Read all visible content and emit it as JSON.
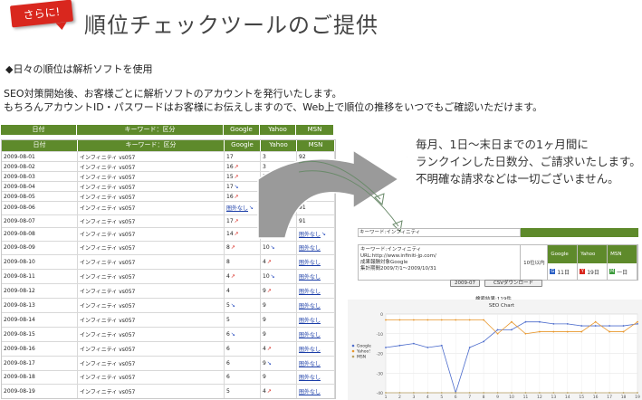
{
  "badge": "さらに!",
  "title": "順位チェックツールのご提供",
  "heading": "◆日々の順位は解析ソフトを使用",
  "desc": [
    "SEO対策開始後、お客様ごとに解析ソフトのアカウントを発行いたします。",
    "もちろんアカウントID・パスワードはお客様にお伝えしますので、Web上で順位の推移をいつでもご確認いただけます。"
  ],
  "notice": [
    "毎月、1日〜末日までの1ヶ月間に",
    "ランクインした日数分、ご請求いたします。",
    "不明確な請求などは一切ございません。"
  ],
  "table": {
    "headers": [
      "日付",
      "キーワード：区分",
      "Google",
      "Yahoo",
      "MSN"
    ],
    "rows": [
      {
        "date": "2009-08-01",
        "kw": "インフィニティ vs057",
        "google": "17",
        "gArr": "",
        "yahoo": "3",
        "yArr": "",
        "msn": "92",
        "mArr": ""
      },
      {
        "date": "2009-08-02",
        "kw": "インフィニティ vs057",
        "google": "16",
        "gArr": "↗",
        "yahoo": "3",
        "yArr": "",
        "msn": "90",
        "mArr": "↗"
      },
      {
        "date": "2009-08-03",
        "kw": "インフィニティ vs057",
        "google": "15",
        "gArr": "↗",
        "yahoo": "3",
        "yArr": "",
        "msn": "",
        "mArr": ""
      },
      {
        "date": "2009-08-04",
        "kw": "インフィニティ vs057",
        "google": "17",
        "gArr": "↘",
        "yahoo": "3",
        "yArr": "",
        "msn": "",
        "mArr": ""
      },
      {
        "date": "2009-08-05",
        "kw": "インフィニティ vs057",
        "google": "16",
        "gArr": "↗",
        "yahoo": "3",
        "yArr": "",
        "msn": "91",
        "mArr": "↘"
      },
      {
        "date": "2009-08-06",
        "kw": "インフィニティ vs057",
        "google": "圏外なし",
        "gArr": "↘",
        "yahoo": "",
        "yArr": "",
        "msn": "91",
        "mArr": ""
      },
      {
        "date": "2009-08-07",
        "kw": "インフィニティ vs057",
        "google": "17",
        "gArr": "↗",
        "yahoo": "",
        "yArr": "",
        "msn": "91",
        "mArr": ""
      },
      {
        "date": "2009-08-08",
        "kw": "インフィニティ vs057",
        "google": "14",
        "gArr": "↗",
        "yahoo": "",
        "yArr": "",
        "msn": "圏外なし",
        "mArr": "↘"
      },
      {
        "date": "2009-08-09",
        "kw": "インフィニティ vs057",
        "google": "8",
        "gArr": "↗",
        "yahoo": "10",
        "yArr": "↘",
        "msn": "圏外なし",
        "mArr": ""
      },
      {
        "date": "2009-08-10",
        "kw": "インフィニティ vs057",
        "google": "8",
        "gArr": "",
        "yahoo": "4",
        "yArr": "↗",
        "msn": "圏外なし",
        "mArr": ""
      },
      {
        "date": "2009-08-11",
        "kw": "インフィニティ vs057",
        "google": "4",
        "gArr": "↗",
        "yahoo": "10",
        "yArr": "↘",
        "msn": "圏外なし",
        "mArr": ""
      },
      {
        "date": "2009-08-12",
        "kw": "インフィニティ vs057",
        "google": "4",
        "gArr": "",
        "yahoo": "9",
        "yArr": "↗",
        "msn": "圏外なし",
        "mArr": ""
      },
      {
        "date": "2009-08-13",
        "kw": "インフィニティ vs057",
        "google": "5",
        "gArr": "↘",
        "yahoo": "9",
        "yArr": "",
        "msn": "圏外なし",
        "mArr": ""
      },
      {
        "date": "2009-08-14",
        "kw": "インフィニティ vs057",
        "google": "5",
        "gArr": "",
        "yahoo": "9",
        "yArr": "",
        "msn": "圏外なし",
        "mArr": ""
      },
      {
        "date": "2009-08-15",
        "kw": "インフィニティ vs057",
        "google": "6",
        "gArr": "↘",
        "yahoo": "9",
        "yArr": "",
        "msn": "圏外なし",
        "mArr": ""
      },
      {
        "date": "2009-08-16",
        "kw": "インフィニティ vs057",
        "google": "6",
        "gArr": "",
        "yahoo": "4",
        "yArr": "↗",
        "msn": "圏外なし",
        "mArr": ""
      },
      {
        "date": "2009-08-17",
        "kw": "インフィニティ vs057",
        "google": "6",
        "gArr": "",
        "yahoo": "9",
        "yArr": "↘",
        "msn": "圏外なし",
        "mArr": ""
      },
      {
        "date": "2009-08-18",
        "kw": "インフィニティ vs057",
        "google": "6",
        "gArr": "",
        "yahoo": "9",
        "yArr": "",
        "msn": "圏外なし",
        "mArr": ""
      },
      {
        "date": "2009-08-19",
        "kw": "インフィニティ vs057",
        "google": "5",
        "gArr": "",
        "yahoo": "4",
        "yArr": "↗",
        "msn": "圏外なし",
        "mArr": ""
      }
    ]
  },
  "report": {
    "keyword": "キーワード:インフィニティ",
    "info": [
      "キーワード:インフィニティ",
      "URL:http://www.infiniti-jp.com/",
      "成果報酬対象Google",
      "集計期間2009/7/1〜2009/10/31"
    ],
    "count": "10位以内",
    "google": {
      "label": "Google",
      "value": "11日",
      "mark": "G",
      "color": "#2a5fc4"
    },
    "yahoo": {
      "label": "Yahoo",
      "value": "19日",
      "mark": "Y",
      "color": "#d9271e"
    },
    "msn": {
      "label": "MSN",
      "value": "一日",
      "mark": "M",
      "color": "#3a9a3a"
    },
    "month": "2009-07",
    "csv": "CSVダウンロード",
    "result": "検索結果:119件"
  },
  "colors": {
    "accent": "#d9271e",
    "table_header": "#5e8a2b",
    "link": "#1b3ea8"
  },
  "chart_data": {
    "type": "line",
    "title": "SEO Chart",
    "x": [
      1,
      2,
      3,
      4,
      5,
      6,
      7,
      8,
      9,
      10,
      11,
      12,
      13,
      14,
      15,
      16,
      17,
      18,
      19
    ],
    "ylim": [
      -40,
      0
    ],
    "yticks": [
      0,
      -10,
      -20,
      -30,
      -40
    ],
    "series": [
      {
        "name": "Google",
        "color": "#4c6ccc",
        "values": [
          -17,
          -16,
          -15,
          -17,
          -16,
          -40,
          -17,
          -14,
          -8,
          -8,
          -4,
          -4,
          -5,
          -5,
          -6,
          -6,
          -6,
          -6,
          -5
        ]
      },
      {
        "name": "Yahoo!",
        "color": "#e8962a",
        "values": [
          -3,
          -3,
          -3,
          -3,
          -3,
          -3,
          -3,
          -3,
          -10,
          -4,
          -10,
          -9,
          -9,
          -9,
          -9,
          -4,
          -9,
          -9,
          -4
        ]
      },
      {
        "name": "MSN",
        "color": "#b8a060",
        "values": [
          -92,
          -90,
          -92,
          -92,
          -91,
          -91,
          -91,
          -92,
          -92,
          -92,
          -92,
          -92,
          -92,
          -92,
          -92,
          -92,
          -92,
          -92,
          -92
        ]
      }
    ]
  }
}
